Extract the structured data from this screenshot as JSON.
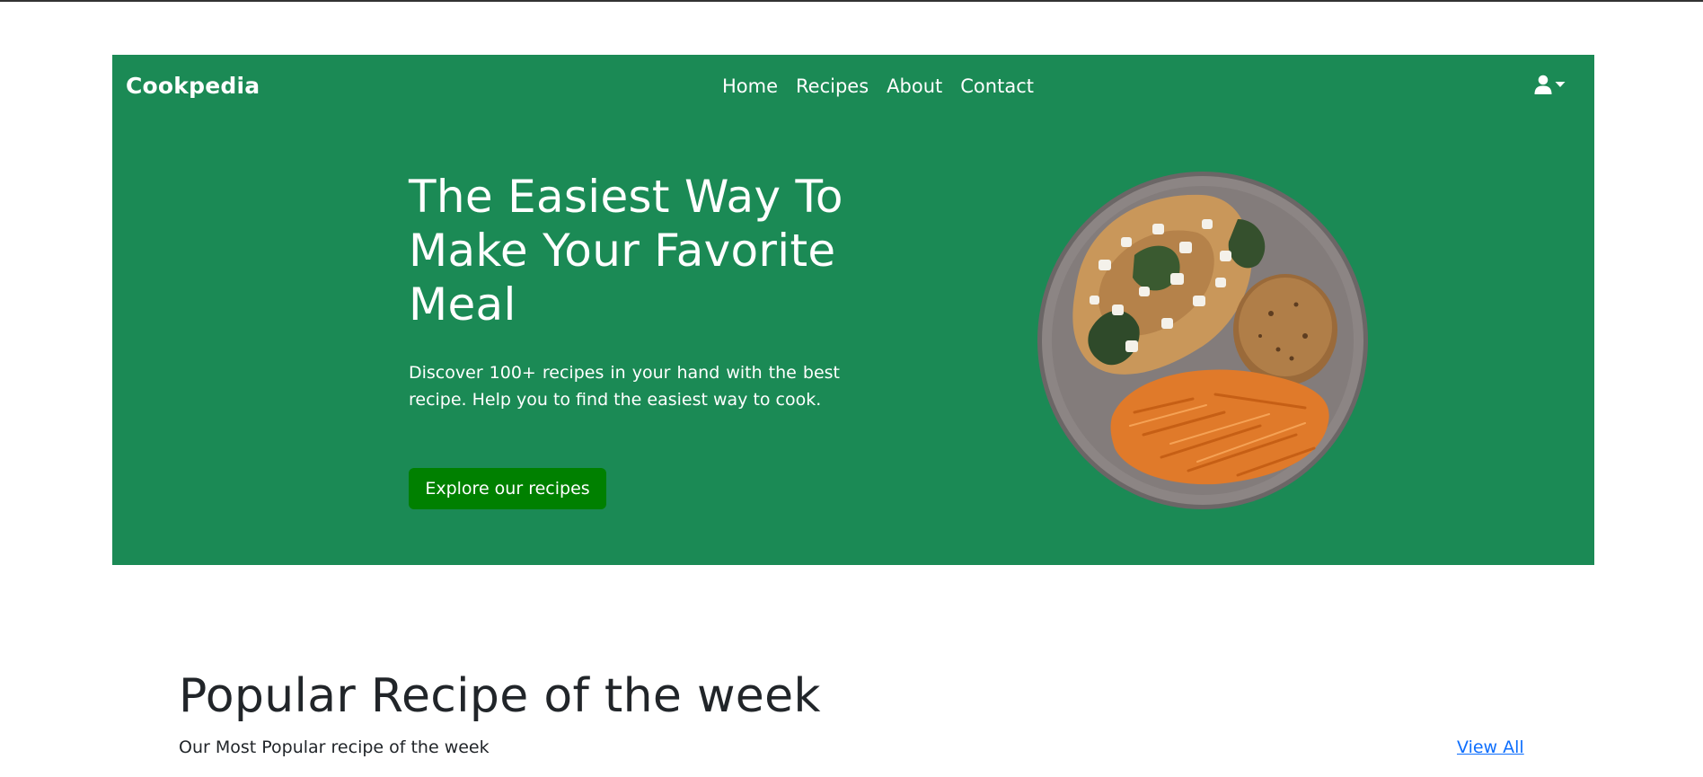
{
  "header": {
    "brand": "Cookpedia",
    "nav": [
      {
        "label": "Home"
      },
      {
        "label": "Recipes"
      },
      {
        "label": "About"
      },
      {
        "label": "Contact"
      }
    ],
    "user_icon": "user-icon",
    "dropdown_icon": "caret-down-icon"
  },
  "hero": {
    "title": "The Easiest Way To Make Your Favorite Meal",
    "description": "Discover 100+ recipes in your hand with the best recipe. Help you to find the easiest way to cook.",
    "cta_label": "Explore our recipes"
  },
  "popular": {
    "title": "Popular Recipe of the week",
    "subtitle": "Our Most Popular recipe of the week",
    "view_all_label": "View All"
  },
  "colors": {
    "hero_bg": "#1b8a55",
    "cta_bg": "#008000",
    "link": "#0d6efd",
    "text_dark": "#212529"
  }
}
